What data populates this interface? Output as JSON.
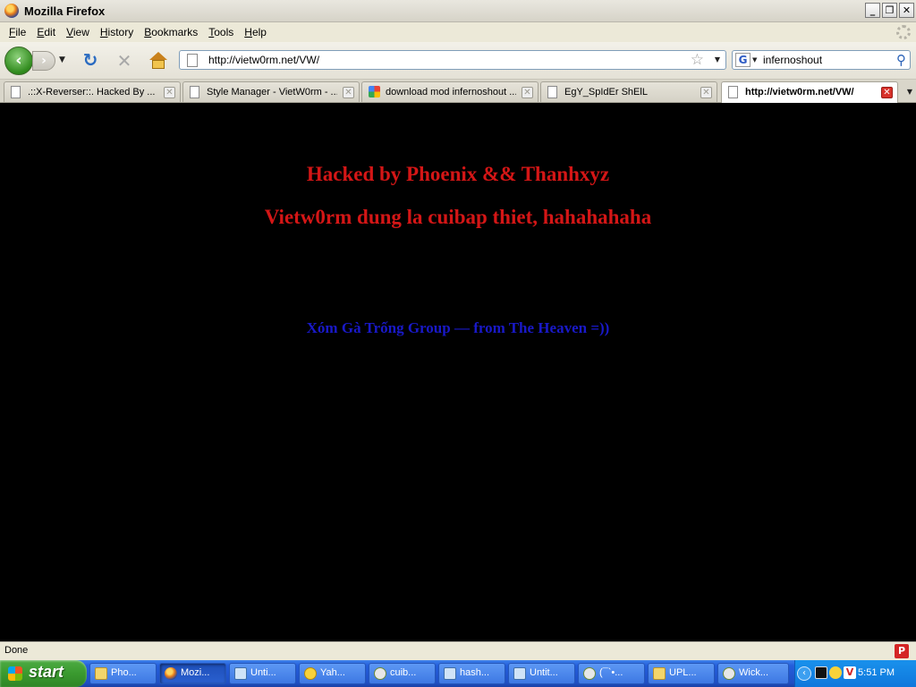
{
  "window": {
    "title": "Mozilla Firefox"
  },
  "menu": [
    "File",
    "Edit",
    "View",
    "History",
    "Bookmarks",
    "Tools",
    "Help"
  ],
  "nav": {
    "url": "http://vietw0rm.net/VW/",
    "search_engine": "G",
    "search_value": "infernoshout"
  },
  "tabs": [
    {
      "label": ".::X-Reverser::. Hacked By ...",
      "icon": "page-icon"
    },
    {
      "label": "Style Manager - VietW0rm - ...",
      "icon": "page-icon"
    },
    {
      "label": "download mod infernoshout ...",
      "icon": "google-icon"
    },
    {
      "label": "EgY_SpIdEr ShElL",
      "icon": "page-icon"
    },
    {
      "label": "http://vietw0rm.net/VW/",
      "icon": "page-icon",
      "active": true
    }
  ],
  "content": {
    "line1": "Hacked by Phoenix && Thanhxyz",
    "line2": "Vietw0rm dung la cuibap thiet, hahahahaha",
    "line3": "Xóm Gà Trống Group — from The Heaven =))"
  },
  "status": {
    "text": "Done"
  },
  "taskbar": {
    "start_label": "start",
    "tasks": [
      {
        "label": "Pho...",
        "icon": "folder-icon"
      },
      {
        "label": "Mozi...",
        "icon": "firefox-icon",
        "active": true
      },
      {
        "label": "Unti...",
        "icon": "notepad-icon"
      },
      {
        "label": "Yah...",
        "icon": "yahoo-messenger-icon"
      },
      {
        "label": "cuib...",
        "icon": "chat-icon"
      },
      {
        "label": "hash...",
        "icon": "notepad-icon"
      },
      {
        "label": "Untit...",
        "icon": "notepad-icon"
      },
      {
        "label": "(¯`•...",
        "icon": "chat-icon"
      },
      {
        "label": "UPL...",
        "icon": "folder-icon"
      },
      {
        "label": "Wick...",
        "icon": "chat-icon"
      }
    ],
    "clock": "5:51 PM"
  },
  "colors": {
    "headline_red": "#d41616",
    "group_blue": "#1919c9",
    "background": "#000000"
  }
}
